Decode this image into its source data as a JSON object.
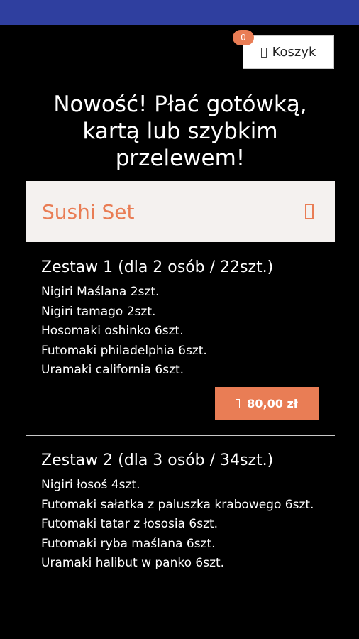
{
  "cart": {
    "label": "Koszyk",
    "count": "0"
  },
  "headline": "Nowość! Płać gotówką, kartą lub szybkim przelewem!",
  "category": {
    "title": "Sushi Set"
  },
  "items": [
    {
      "title": "Zestaw 1 (dla 2 osób / 22szt.)",
      "lines": [
        "Nigiri Maślana 2szt.",
        "Nigiri tamago 2szt.",
        "Hosomaki oshinko 6szt.",
        "Futomaki philadelphia 6szt.",
        "Uramaki california 6szt."
      ],
      "price": "80,00 zł"
    },
    {
      "title": "Zestaw 2 (dla 3 osób / 34szt.)",
      "lines": [
        "Nigiri łosoś 4szt.",
        "Futomaki sałatka z paluszka krabowego 6szt.",
        "Futomaki tatar z łososia 6szt.",
        "Futomaki ryba maślana 6szt.",
        "Uramaki halibut w panko 6szt."
      ]
    }
  ],
  "colors": {
    "accent": "#e97d55",
    "status_bar": "#2f3f9f",
    "category_bg": "#f4f1ef"
  }
}
